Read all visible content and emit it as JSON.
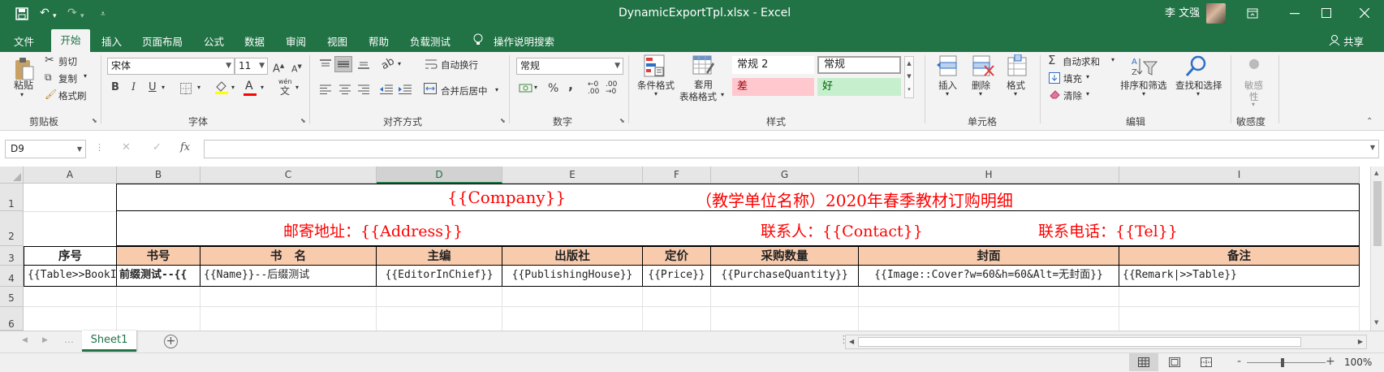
{
  "title_bar": {
    "document_title": "DynamicExportTpl.xlsx  -  Excel",
    "user_name": "李 文强",
    "icons": [
      "save-icon",
      "undo-icon",
      "redo-icon",
      "customize-qat-icon",
      "ribbon-display-icon",
      "minimize-icon",
      "maximize-icon",
      "close-icon"
    ]
  },
  "menu": {
    "tabs": [
      "文件",
      "开始",
      "插入",
      "页面布局",
      "公式",
      "数据",
      "审阅",
      "视图",
      "帮助",
      "负载测试"
    ],
    "active_tab": "开始",
    "tell_me": "操作说明搜索",
    "share": "共享"
  },
  "ribbon": {
    "clipboard": {
      "paste": "粘贴",
      "cut": "剪切",
      "copy": "复制",
      "format_painter": "格式刷",
      "group_label": "剪贴板"
    },
    "font": {
      "font_name": "宋体",
      "font_size": "11",
      "bold": "B",
      "italic": "I",
      "underline": "U",
      "font_color_glyph": "A",
      "wen_glyph": "wén",
      "group_label": "字体"
    },
    "alignment": {
      "wrap_text": "自动换行",
      "merge_center": "合并后居中",
      "group_label": "对齐方式"
    },
    "number": {
      "format": "常规",
      "percent": "%",
      "comma": ",",
      "group_label": "数字"
    },
    "styles": {
      "conditional_format": "条件格式",
      "table_format_l1": "套用",
      "table_format_l2": "表格格式",
      "cells": [
        "常规 2",
        "常规",
        "差",
        "好"
      ],
      "group_label": "样式"
    },
    "cells": {
      "insert": "插入",
      "delete": "删除",
      "format": "格式",
      "group_label": "单元格"
    },
    "editing": {
      "autosum": "自动求和",
      "fill": "填充",
      "clear": "清除",
      "sort_filter": "排序和筛选",
      "find_select": "查找和选择",
      "group_label": "编辑"
    },
    "sensitivity": {
      "label_l1": "敏感",
      "label_l2": "性",
      "group_label": "敏感度"
    }
  },
  "formula_bar": {
    "name_box": "D9",
    "fx": "fx",
    "formula": ""
  },
  "sheet": {
    "columns": [
      "A",
      "B",
      "C",
      "D",
      "E",
      "F",
      "G",
      "H",
      "I"
    ],
    "rows": [
      "1",
      "2",
      "3",
      "4",
      "5",
      "6"
    ],
    "selected_column": "D",
    "row1_company": "{{Company}}",
    "row1_title": "（教学单位名称）2020年春季教材订购明细",
    "row2_address": "邮寄地址：{{Address}}",
    "row2_contact": "联系人：{{Contact}}",
    "row2_tel": "联系电话：{{Tel}}",
    "headers": [
      "序号",
      "书号",
      "书   名",
      "主编",
      "出版社",
      "定价",
      "采购数量",
      "封面",
      "备注"
    ],
    "row4": [
      "{{Table>>BookI",
      "前缀测试--{{",
      "{{Name}}--后缀测试",
      "{{EditorInChief}}",
      "{{PublishingHouse}}",
      "{{Price}}",
      "{{PurchaseQuantity}}",
      "{{Image::Cover?w=60&h=60&Alt=无封面}}",
      "{{Remark|>>Table}}"
    ],
    "accent_colors": {
      "header_fill": "#f8cbad",
      "title_text": "#ff0000",
      "excel_green": "#217346"
    }
  },
  "tabs": {
    "sheet1": "Sheet1",
    "add_sheet": "+"
  },
  "status": {
    "zoom": "100%",
    "zoom_minus": "-",
    "zoom_plus": "+"
  }
}
